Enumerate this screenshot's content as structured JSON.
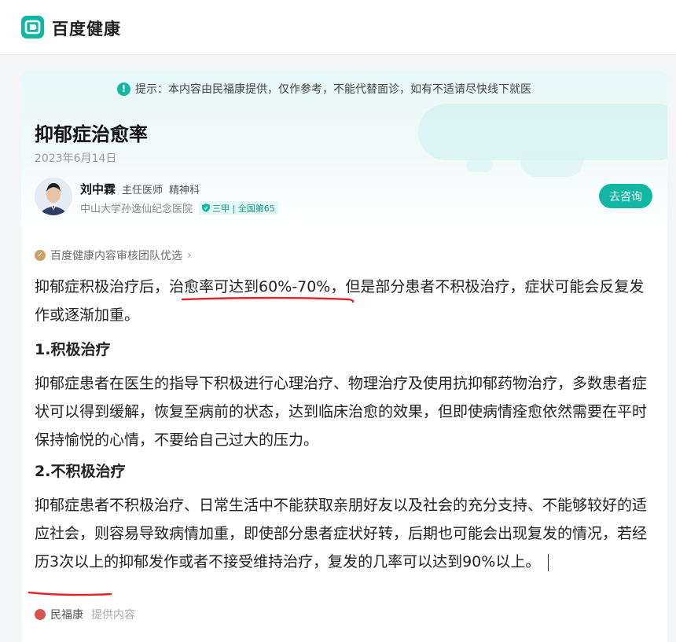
{
  "app": {
    "brand": "百度健康",
    "logo_icon": "baidu-health-logo-icon"
  },
  "notice": {
    "text": "提示：本内容由民福康提供，仅作参考，不能代替面诊，如有不适请尽快线下就医"
  },
  "article": {
    "title": "抑郁症治愈率",
    "date": "2023年6月14日",
    "doctor": {
      "name": "刘中霖",
      "title": "主任医师",
      "dept": "精神科",
      "hospital": "中山大学孙逸仙纪念医院",
      "badge": "三甲 | 全国第65"
    },
    "consult_label": "去咨询",
    "review_label": "百度健康内容审核团队优选",
    "p1_before": "抑郁症积极治疗后，",
    "p1_highlight": "治愈率可达到60%-70%",
    "p1_after": "，但是部分患者不积极治疗，症状可能会反复发作或逐渐加重。",
    "h1": "1.积极治疗",
    "p2": "抑郁症患者在医生的指导下积极进行心理治疗、物理治疗及使用抗抑郁药物治疗，多数患者症状可以得到缓解，恢复至病前的状态，达到临床治愈的效果，但即使病情痊愈依然需要在平时保持愉悦的心情，不要给自己过大的压力。",
    "h2": "2.不积极治疗",
    "p3_main": "抑郁症患者不积极治疗、日常生活中不能获取亲朋好友以及社会的充分支持、不能够较好的适应社会，则容易导致病情加重，即使部分患者症状好转，后期也可能会出现复发的情况，若经历3次以上的抑郁发作或者不接受维持治疗，复发的几率可以达到",
    "p3_end": "90%以上。",
    "source_name": "民福康",
    "source_label": "提供内容"
  },
  "colors": {
    "accent": "#12b7a4",
    "annotation": "#e0242a"
  }
}
